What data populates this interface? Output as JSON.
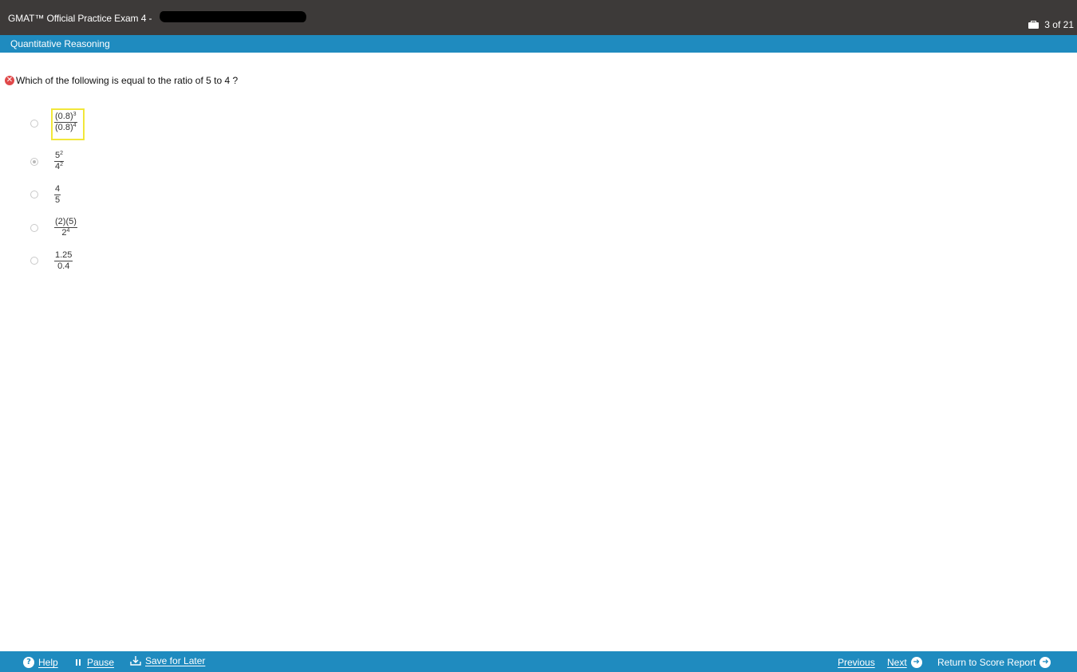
{
  "header": {
    "title": "GMAT™ Official Practice Exam 4 -",
    "progress": "3 of 21"
  },
  "section": {
    "name": "Quantitative Reasoning"
  },
  "question": {
    "text": "Which of the following is equal to the ratio of 5 to 4 ?",
    "status_icon": "incorrect-x-icon"
  },
  "options": [
    {
      "numerator": "(0.8)",
      "num_exp": "3",
      "denominator": "(0.8)",
      "den_exp": "4",
      "selected": false,
      "highlighted": true
    },
    {
      "numerator": "5",
      "num_exp": "2",
      "denominator": "4",
      "den_exp": "2",
      "selected": true,
      "highlighted": false
    },
    {
      "numerator": "4",
      "num_exp": "",
      "denominator": "5",
      "den_exp": "",
      "selected": false,
      "highlighted": false
    },
    {
      "numerator": "(2)(5)",
      "num_exp": "",
      "denominator": "2",
      "den_exp": "4",
      "selected": false,
      "highlighted": false
    },
    {
      "numerator": "1.25",
      "num_exp": "",
      "denominator": "0.4",
      "den_exp": "",
      "selected": false,
      "highlighted": false
    }
  ],
  "toolbar": {
    "help_label": "Help",
    "pause_label": "Pause",
    "save_label": "Save for Later",
    "previous_label": "Previous",
    "next_label": "Next",
    "return_label": "Return to Score Report"
  },
  "colors": {
    "titlebar": "#3d3a39",
    "accent": "#1f8bbf",
    "highlight": "#f2e73a",
    "incorrect": "#e0494a"
  }
}
